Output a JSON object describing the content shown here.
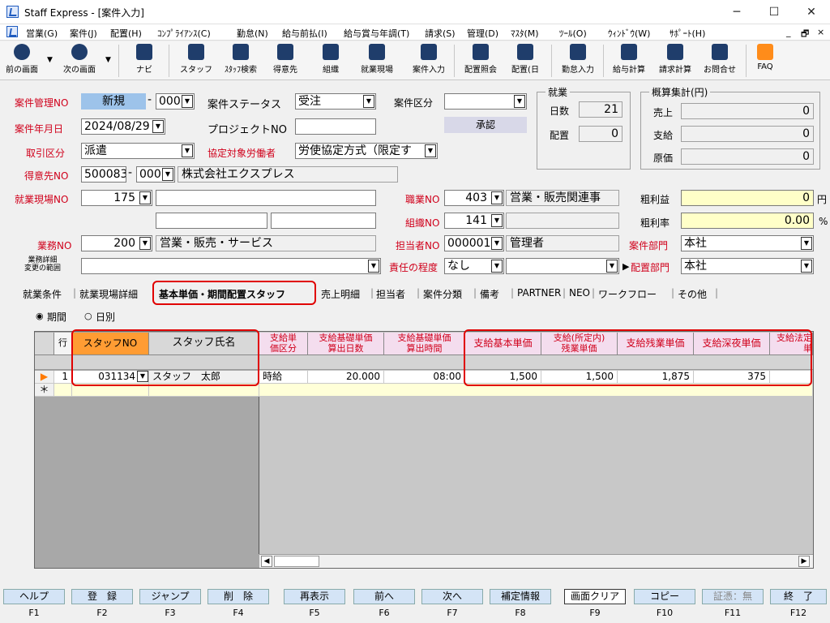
{
  "window": {
    "title": "Staff Express - [案件入力]",
    "min": "─",
    "max": "☐",
    "close": "✕"
  },
  "menu": [
    "営業(G)",
    "案件(J)",
    "配置(H)",
    "ｺﾝﾌﾟﾗｲｱﾝｽ(C)",
    "勤怠(N)",
    "給与前払(I)",
    "給与賞与年調(T)",
    "請求(S)",
    "管理(D)",
    "ﾏｽﾀ(M)",
    "ﾂｰﾙ(O)",
    "ｳｨﾝﾄﾞｳ(W)",
    "ｻﾎﾟｰﾄ(H)"
  ],
  "mdi": {
    "min": "_",
    "restore": "🗗",
    "close": "×"
  },
  "toolbar": [
    "前の画面",
    "次の画面",
    "ナビ",
    "スタッフ",
    "ｽﾀｯﾌ検索",
    "得意先",
    "組織",
    "就業現場",
    "案件入力",
    "配置照会",
    "配置(日",
    "勤怠入力",
    "給与計算",
    "請求計算",
    "お問合せ",
    "FAQ"
  ],
  "form": {
    "l_case_no": "案件管理NO",
    "case_no": "新規",
    "case_sub": "000",
    "l_status": "案件ステータス",
    "status": "受注",
    "l_case_kind": "案件区分",
    "case_kind": "",
    "l_date": "案件年月日",
    "date": "2024/08/29",
    "l_project": "プロジェクトNO",
    "project": "",
    "approve": "承認",
    "l_trade": "取引区分",
    "trade": "派遣",
    "l_agree": "協定対象労働者",
    "agree": "労使協定方式（限定す",
    "l_client": "得意先NO",
    "client_no": "500083",
    "client_sub": "000",
    "client_name": "株式会社エクスプレス",
    "l_site": "就業現場NO",
    "site_no": "175",
    "l_job": "職業NO",
    "job_no": "403",
    "job_name": "営業・販売関連事",
    "l_org": "組織NO",
    "org_no": "141",
    "l_work": "業務NO",
    "work_no": "200",
    "work_name": "営業・販売・サービス",
    "l_person": "担当者NO",
    "person_no": "000001",
    "person_name": "管理者",
    "l_detail": "業務詳細\n変更の範囲",
    "l_resp": "責任の程度",
    "resp": "なし",
    "l_gp": "粗利益",
    "gp": "0",
    "gp_unit": "円",
    "l_gpr": "粗利率",
    "gpr": "0.00",
    "gpr_unit": "%",
    "l_case_dept": "案件部門",
    "case_dept": "本社",
    "l_place_dept": "配置部門",
    "place_dept": "本社"
  },
  "employment": {
    "title": "就業",
    "l_days": "日数",
    "days": "21",
    "l_place": "配置",
    "place": "0"
  },
  "summary": {
    "title": "概算集計(円)",
    "l_sales": "売上",
    "sales": "0",
    "l_pay": "支給",
    "pay": "0",
    "l_cost": "原価",
    "cost": "0"
  },
  "tabs": [
    "就業条件",
    "就業現場詳細",
    "基本単価・期間配置スタッフ",
    "売上明細",
    "担当者",
    "案件分類",
    "備考",
    "PARTNER",
    "NEO",
    "ワークフロー",
    "その他"
  ],
  "radio": {
    "period": "期間",
    "daily": "日別"
  },
  "grid": {
    "h_row": "行",
    "h_staff_no": "スタッフNO",
    "h_staff_name": "スタッフ氏名",
    "h_c1": "支給単\n価区分",
    "h_c2": "支給基礎単価\n算出日数",
    "h_c3": "支給基礎単価\n算出時間",
    "h_c4": "支給基本単価",
    "h_c5": "支給(所定内)\n残業単価",
    "h_c6": "支給残業単価",
    "h_c7": "支給深夜単価",
    "h_c8": "支給法定\n単",
    "row": {
      "idx": "1",
      "staff_no": "031134",
      "staff_name": "スタッフ　太郎",
      "c1": "時給",
      "c2": "20.000",
      "c3": "08:00",
      "c4": "1,500",
      "c5": "1,500",
      "c6": "1,875",
      "c7": "375",
      "c8": ""
    },
    "new_marker": "＊",
    "cur_marker": "▶"
  },
  "fkeys": [
    {
      "label": "ヘルプ",
      "key": "F1"
    },
    {
      "label": "登　録",
      "key": "F2"
    },
    {
      "label": "ジャンプ",
      "key": "F3"
    },
    {
      "label": "削　除",
      "key": "F4"
    },
    {
      "label": "再表示",
      "key": "F5"
    },
    {
      "label": "前へ",
      "key": "F6"
    },
    {
      "label": "次へ",
      "key": "F7"
    },
    {
      "label": "補定情報",
      "key": "F8"
    },
    {
      "label": "画面クリア",
      "key": "F9"
    },
    {
      "label": "コピー",
      "key": "F10"
    },
    {
      "label": "証憑：無",
      "key": "F11"
    },
    {
      "label": "終　了",
      "key": "F12"
    }
  ]
}
